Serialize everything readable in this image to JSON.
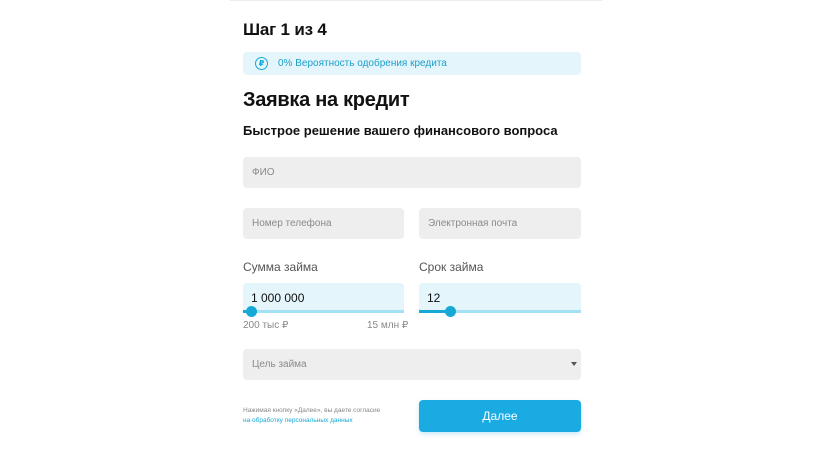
{
  "step": {
    "title": "Шаг 1 из 4"
  },
  "approval": {
    "icon": "ruble-icon",
    "icon_glyph": "₽",
    "text": "0% Вероятность одобрения кредита"
  },
  "form": {
    "title": "Заявка на кредит",
    "subtitle": "Быстрое решение вашего финансового вопроса"
  },
  "fields": {
    "fio": {
      "placeholder": "ФИО"
    },
    "phone": {
      "placeholder": "Номер телефона"
    },
    "email": {
      "placeholder": "Электронная почта"
    },
    "purpose": {
      "placeholder": "Цель займа",
      "icon": "chevron-down-icon"
    }
  },
  "amount": {
    "label": "Сумма займа",
    "value": "1 000 000",
    "min_label": "200 тыс ₽",
    "max_label": "15 млн ₽",
    "fraction": 0.05
  },
  "term": {
    "label": "Срок займа",
    "value": "12",
    "fraction": 0.19
  },
  "consent": {
    "text": "Нажимая кнопку «Далее», вы даете согласие",
    "link": "на обработку персональных данных"
  },
  "next_button": {
    "label": "Далее"
  },
  "colors": {
    "accent": "#1aabe3",
    "accent_light": "#e4f6fc",
    "field_bg": "#eeeeee"
  }
}
